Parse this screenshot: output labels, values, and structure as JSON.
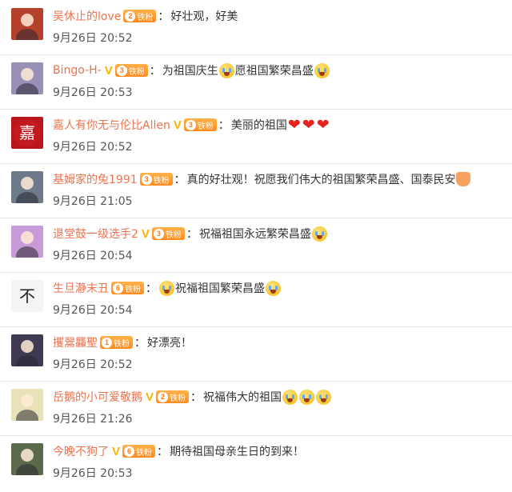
{
  "comments": [
    {
      "username": "吴休止的love",
      "verified": false,
      "fan_level": "2",
      "fan_label": "铁粉",
      "segments": [
        {
          "t": "text",
          "v": "好壮观，好美"
        }
      ],
      "time": "9月26日 20:52",
      "avatar": {
        "icon": "anime-character-avatar",
        "color": "#b5412b"
      }
    },
    {
      "username": "Bingo-H-",
      "verified": true,
      "fan_level": "3",
      "fan_label": "铁粉",
      "segments": [
        {
          "t": "text",
          "v": "为祖国庆生"
        },
        {
          "t": "emoji"
        },
        {
          "t": "text",
          "v": "愿祖国繁荣昌盛"
        },
        {
          "t": "emoji"
        }
      ],
      "time": "9月26日 20:53",
      "avatar": {
        "icon": "person-avatar",
        "color": "#9a8fb6"
      }
    },
    {
      "username": "嘉人有你无与伦比Allen",
      "verified": true,
      "fan_level": "3",
      "fan_label": "铁粉",
      "segments": [
        {
          "t": "text",
          "v": "美丽的祖国"
        },
        {
          "t": "heart"
        },
        {
          "t": "heart"
        },
        {
          "t": "heart"
        }
      ],
      "time": "9月26日 20:52",
      "avatar": {
        "icon": "calligraphy-avatar",
        "color": "#b8161b",
        "glyph": "嘉"
      }
    },
    {
      "username": "基姆家的兔1991",
      "verified": false,
      "fan_level": "3",
      "fan_label": "铁粉",
      "segments": [
        {
          "t": "text",
          "v": "真的好壮观！祝愿我们伟大的祖国繁荣昌盛、国泰民安"
        },
        {
          "t": "hand"
        }
      ],
      "time": "9月26日 21:05",
      "avatar": {
        "icon": "person-avatar",
        "color": "#6c7a8a"
      }
    },
    {
      "username": "退堂鼓一级选手2",
      "verified": true,
      "fan_level": "3",
      "fan_label": "铁粉",
      "segments": [
        {
          "t": "text",
          "v": "祝福祖国永远繁荣昌盛"
        },
        {
          "t": "emoji"
        }
      ],
      "time": "9月26日 20:54",
      "avatar": {
        "icon": "anime-character-avatar",
        "color": "#c99ad8"
      }
    },
    {
      "username": "生旦瀞末丑",
      "verified": false,
      "fan_level": "6",
      "fan_label": "铁粉",
      "segments": [
        {
          "t": "emoji"
        },
        {
          "t": "text",
          "v": "祝福祖国繁荣昌盛"
        },
        {
          "t": "emoji"
        }
      ],
      "time": "9月26日 20:54",
      "avatar": {
        "icon": "calligraphy-avatar",
        "color": "#f4f4f4",
        "glyph": "不"
      }
    },
    {
      "username": "攫翯龘聖",
      "verified": false,
      "fan_level": "1",
      "fan_label": "铁粉",
      "segments": [
        {
          "t": "text",
          "v": "好漂亮！"
        }
      ],
      "time": "9月26日 20:52",
      "avatar": {
        "icon": "person-avatar",
        "color": "#3f3a52"
      }
    },
    {
      "username": "岳鹅的小可爱敬鹅",
      "verified": true,
      "fan_level": "2",
      "fan_label": "铁粉",
      "segments": [
        {
          "t": "text",
          "v": "祝福伟大的祖国"
        },
        {
          "t": "emoji"
        },
        {
          "t": "emoji"
        },
        {
          "t": "emoji"
        }
      ],
      "time": "9月26日 21:26",
      "avatar": {
        "icon": "cartoon-avatar",
        "color": "#e9e2b8"
      }
    },
    {
      "username": "今晚不狗了",
      "verified": true,
      "fan_level": "6",
      "fan_label": "铁粉",
      "segments": [
        {
          "t": "text",
          "v": "期待祖国母亲生日的到来！"
        }
      ],
      "time": "9月26日 20:53",
      "avatar": {
        "icon": "person-avatar",
        "color": "#5b6a4a"
      }
    }
  ],
  "colon": "：",
  "verified_glyph": "V",
  "colors": {
    "username": "#eb7350",
    "text": "#333333",
    "time": "#555555",
    "badge": "#ff8a1c",
    "verified": "#f7b500"
  }
}
